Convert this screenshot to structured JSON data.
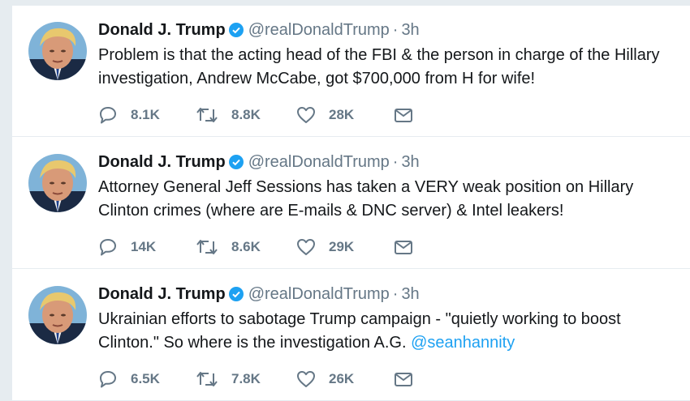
{
  "tweets": [
    {
      "name": "Donald J. Trump",
      "handle": "@realDonaldTrump",
      "separator": "·",
      "time": "3h",
      "text": "Problem is that the acting head of the FBI & the person in charge of the Hillary investigation, Andrew McCabe, got $700,000 from H for wife!",
      "mention": "",
      "replies": "8.1K",
      "retweets": "8.8K",
      "likes": "28K"
    },
    {
      "name": "Donald J. Trump",
      "handle": "@realDonaldTrump",
      "separator": "·",
      "time": "3h",
      "text": "Attorney General Jeff Sessions has taken a VERY weak position on Hillary Clinton crimes (where are E-mails & DNC server) & Intel leakers!",
      "mention": "",
      "replies": "14K",
      "retweets": "8.6K",
      "likes": "29K"
    },
    {
      "name": "Donald J. Trump",
      "handle": "@realDonaldTrump",
      "separator": "·",
      "time": "3h",
      "text": "Ukrainian efforts to sabotage Trump campaign - \"quietly working to boost Clinton.\" So where is the investigation A.G. ",
      "mention": "@seanhannity",
      "replies": "6.5K",
      "retweets": "7.8K",
      "likes": "26K"
    }
  ],
  "icons": {
    "reply": "reply-icon",
    "retweet": "retweet-icon",
    "like": "heart-icon",
    "message": "envelope-icon",
    "verified": "verified-badge-icon"
  },
  "colors": {
    "link": "#1da1f2",
    "muted": "#657786",
    "text": "#14171a"
  }
}
